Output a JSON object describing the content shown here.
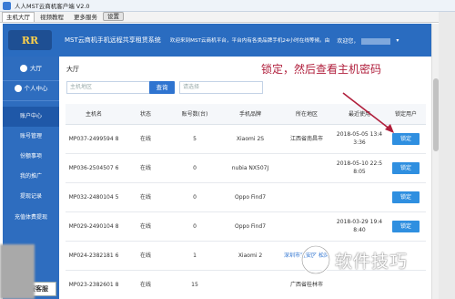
{
  "window": {
    "title": "人人MST云商机客户端 V2.0"
  },
  "menu": {
    "tabs": [
      "主机大厅",
      "视频教程",
      "更多服务"
    ],
    "button": "设置"
  },
  "header": {
    "logo_text": "RR",
    "title": "MST云商机手机远程共享租赁系统",
    "notice": "欢迎来到MST云商机平台，平台内有各类品牌手机24小时在线等候。由",
    "welcome": "欢迎您，",
    "caret": "▾"
  },
  "sidebar": {
    "hall": "大厅",
    "personal": "个人中心",
    "items": [
      "账户中心",
      "账号管理",
      "份额事项",
      "我的推广",
      "提现记录",
      "充值体费提现"
    ],
    "service": "客服客服"
  },
  "content": {
    "title": "大厅",
    "search_placeholder": "主机地区",
    "search_button": "查询",
    "select_placeholder": "请选择",
    "annotation": "锁定，然后查看主机密码"
  },
  "table": {
    "headers": [
      "主机名",
      "状态",
      "账号数(台)",
      "手机品牌",
      "所在地区",
      "最近使用",
      "锁定用户"
    ],
    "rows": [
      [
        "MP037-2499594 8",
        "在线",
        "5",
        "Xiaomi 2S",
        "江西省南昌市",
        "2018-05-05 13:4 3:36",
        "锁定"
      ],
      [
        "MP036-2504507 6",
        "在线",
        "0",
        "nubia NX507J",
        "",
        "2018-05-10 22:5 8:05",
        "锁定"
      ],
      [
        "MP032-2480104 5",
        "在线",
        "0",
        "Oppo Find7",
        "",
        "",
        "锁定"
      ],
      [
        "MP029-2490104 8",
        "在线",
        "0",
        "Oppo Find7",
        "",
        "2018-03-29 19:4 8:40",
        "锁定"
      ],
      [
        "MP024-2382181 6",
        "在线",
        "1",
        "Xiaomi 2",
        "深圳市宝安区 松岗",
        "",
        ""
      ],
      [
        "MP023-2382601 8",
        "在线",
        "15",
        "",
        "广西省桂林市",
        "",
        ""
      ]
    ]
  },
  "watermark": {
    "text": "软件技巧"
  },
  "colors": {
    "header": "#2a6cc0",
    "sidebar": "#2e6dbf",
    "button": "#2f8fe0",
    "annotation": "#b01f3c"
  }
}
